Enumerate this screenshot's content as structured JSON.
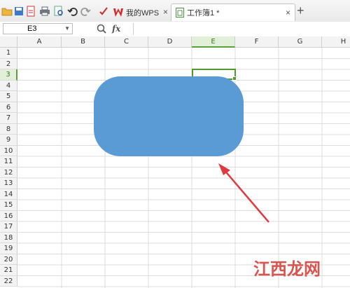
{
  "tabs": [
    {
      "label": "我的WPS",
      "close": "×"
    },
    {
      "label": "工作簿1 *",
      "close": "×"
    }
  ],
  "new_tab": "+",
  "name_box": "E3",
  "fx_label": "fx",
  "columns": [
    "A",
    "B",
    "C",
    "D",
    "E",
    "F",
    "G",
    "H"
  ],
  "rows": [
    "1",
    "2",
    "3",
    "4",
    "5",
    "6",
    "7",
    "8",
    "9",
    "10",
    "11",
    "12",
    "13",
    "14",
    "15",
    "16",
    "17",
    "18",
    "19",
    "20",
    "21",
    "22"
  ],
  "active_cell": {
    "column": "E",
    "row": "3"
  },
  "shape": {
    "type": "rounded-rectangle",
    "fill": "#5b9bd5"
  },
  "annotation": {
    "type": "arrow",
    "color": "#e0393e"
  },
  "watermark": "江西龙网",
  "colors": {
    "selection": "#4f9a2e",
    "header_bg": "#f3f3f3",
    "wps_red": "#d52a2a"
  }
}
